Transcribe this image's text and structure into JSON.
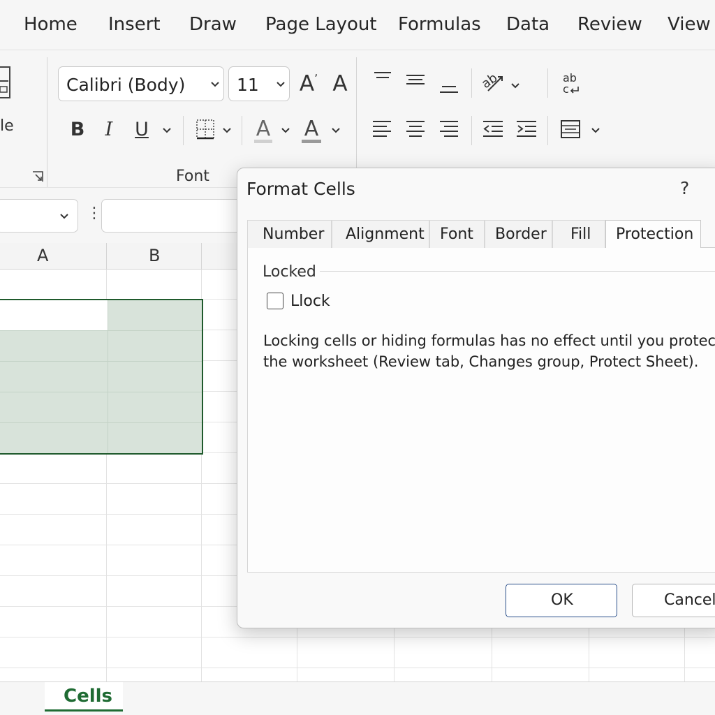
{
  "menu": {
    "tabs": [
      "Home",
      "Insert",
      "Draw",
      "Page Layout",
      "Formulas",
      "Data",
      "Review",
      "View"
    ]
  },
  "ribbon": {
    "left_group_label_fragment": "le",
    "font": {
      "family": "Calibri (Body)",
      "size": "11",
      "group_label": "Font",
      "bold_label": "B",
      "italic_label": "I",
      "underline_label": "U",
      "increase_size_label": "A",
      "decrease_size_label": "A",
      "highlight_label": "A",
      "font_color_label": "A"
    },
    "icons": [
      "align-top-icon",
      "align-middle-icon",
      "align-bottom-icon",
      "orientation-icon",
      "wrap-text-icon",
      "align-left-icon",
      "align-center-icon",
      "align-right-icon",
      "decrease-indent-icon",
      "increase-indent-icon",
      "merge-icon"
    ],
    "wrap_text_glyph": "ab\nc↲"
  },
  "formula_bar": {
    "separator": "⋮",
    "content": ""
  },
  "grid": {
    "columns": [
      "A",
      "B"
    ]
  },
  "sheet_tabs": [
    "Cells"
  ],
  "dialog": {
    "title": "Format Cells",
    "help": "?",
    "tabs": [
      "Number",
      "Alignment",
      "Font",
      "Border",
      "Fill",
      "Protection"
    ],
    "active_tab": "Protection",
    "locked_group_label": "Locked",
    "checkbox_label": "Llock",
    "checkbox_checked": false,
    "note": "Locking cells or hiding formulas has no effect until you protect the worksheet (Review tab, Changes group, Protect Sheet).",
    "ok_label": "OK",
    "cancel_label": "Cancel"
  },
  "colors": {
    "selection_fill": "#d8e3da",
    "selection_border": "#1f5a2c",
    "sheet_tab_accent": "#1f6b33",
    "ok_border": "#2a4f8a"
  }
}
